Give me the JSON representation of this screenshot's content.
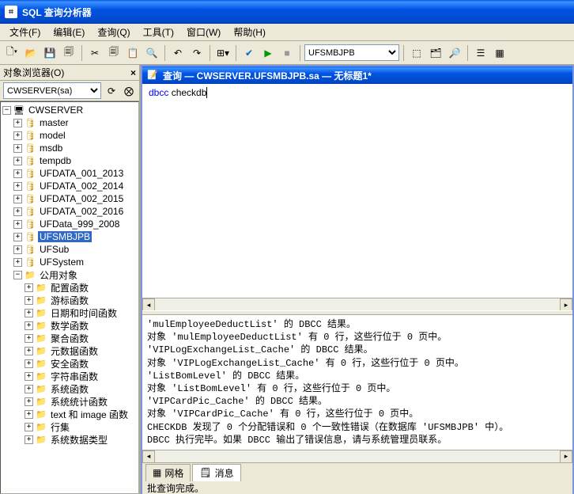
{
  "window": {
    "title": "SQL 查询分析器"
  },
  "menu": {
    "file": "文件(F)",
    "edit": "编辑(E)",
    "query": "查询(Q)",
    "tools": "工具(T)",
    "window": "窗口(W)",
    "help": "帮助(H)"
  },
  "toolbar": {
    "db_selected": "UFSMBJPB"
  },
  "object_browser": {
    "title": "对象浏览器(O)",
    "server_selected": "CWSERVER(sa)",
    "root": "CWSERVER",
    "databases": [
      "master",
      "model",
      "msdb",
      "tempdb",
      "UFDATA_001_2013",
      "UFDATA_002_2014",
      "UFDATA_002_2015",
      "UFDATA_002_2016",
      "UFData_999_2008",
      "UFSMBJPB",
      "UFSub",
      "UFSystem"
    ],
    "selected_db": "UFSMBJPB",
    "common_objects": "公用对象",
    "folders": [
      "配置函数",
      "游标函数",
      "日期和时间函数",
      "数学函数",
      "聚合函数",
      "元数据函数",
      "安全函数",
      "字符串函数",
      "系统函数",
      "系统统计函数",
      "text 和 image 函数",
      "行集",
      "系统数据类型"
    ]
  },
  "query_window": {
    "title": "查询 — CWSERVER.UFSMBJPB.sa — 无标题1*",
    "sql_keyword": "dbcc",
    "sql_rest": " checkdb"
  },
  "results": {
    "lines": [
      "'mulEmployeeDeductList' 的 DBCC 结果。",
      "对象 'mulEmployeeDeductList' 有 0 行，这些行位于 0 页中。",
      "'VIPLogExchangeList_Cache' 的 DBCC 结果。",
      "对象 'VIPLogExchangeList_Cache' 有 0 行，这些行位于 0 页中。",
      "'ListBomLevel' 的 DBCC 结果。",
      "对象 'ListBomLevel' 有 0 行，这些行位于 0 页中。",
      "'VIPCardPic_Cache' 的 DBCC 结果。",
      "对象 'VIPCardPic_Cache' 有 0 行，这些行位于 0 页中。",
      "CHECKDB 发现了 0 个分配错误和 0 个一致性错误（在数据库 'UFSMBJPB' 中）。",
      "DBCC 执行完毕。如果 DBCC 输出了错误信息，请与系统管理员联系。"
    ]
  },
  "tabs": {
    "grid": "网格",
    "messages": "消息"
  },
  "status": {
    "text": "批查询完成。"
  }
}
